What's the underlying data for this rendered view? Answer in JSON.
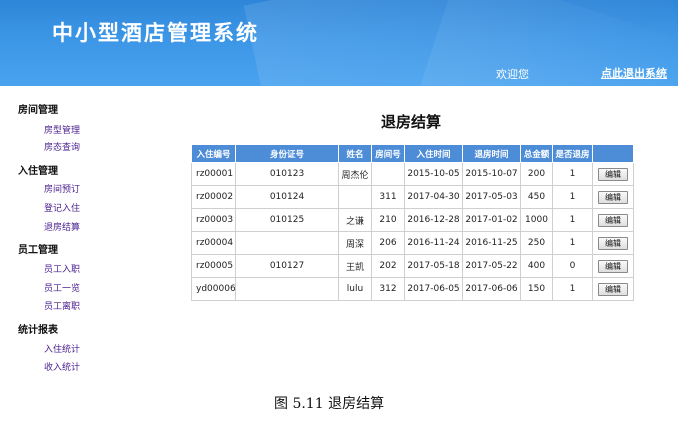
{
  "header": {
    "title": "中小型酒店管理系统",
    "welcome": "欢迎您",
    "logout": "点此退出系统"
  },
  "sidebar": {
    "groups": [
      {
        "title": "房间管理",
        "items": [
          "房型管理",
          "房态查询"
        ]
      },
      {
        "title": "入住管理",
        "items": [
          "房间预订",
          "登记入住",
          "退房结算"
        ]
      },
      {
        "title": "员工管理",
        "items": [
          "员工入职",
          "员工一览",
          "员工离职"
        ]
      },
      {
        "title": "统计报表",
        "items": [
          "入住统计",
          "收入统计"
        ]
      }
    ]
  },
  "main": {
    "title": "退房结算",
    "columns": [
      "入住编号",
      "身份证号",
      "姓名",
      "房间号",
      "入住时间",
      "退房时间",
      "总金额",
      "是否退房",
      ""
    ],
    "rows": [
      [
        "rz00001",
        "010123",
        "周杰伦",
        "",
        "2015-10-05",
        "2015-10-07",
        "200",
        "1",
        "编辑"
      ],
      [
        "rz00002",
        "010124",
        "",
        "311",
        "2017-04-30",
        "2017-05-03",
        "450",
        "1",
        "编辑"
      ],
      [
        "rz00003",
        "010125",
        "之谦",
        "210",
        "2016-12-28",
        "2017-01-02",
        "1000",
        "1",
        "编辑"
      ],
      [
        "rz00004",
        "",
        "周深",
        "206",
        "2016-11-24",
        "2016-11-25",
        "250",
        "1",
        "编辑"
      ],
      [
        "rz00005",
        "010127",
        "王凯",
        "202",
        "2017-05-18",
        "2017-05-22",
        "400",
        "0",
        "编辑"
      ],
      [
        "yd00006",
        "",
        "lulu",
        "312",
        "2017-06-05",
        "2017-06-06",
        "150",
        "1",
        "编辑"
      ]
    ]
  },
  "caption": "图 5.11  退房结算",
  "colors": {
    "header_blue": "#3c96e6",
    "table_header": "#4d8cd6",
    "nav_link": "#4a1f8f"
  }
}
